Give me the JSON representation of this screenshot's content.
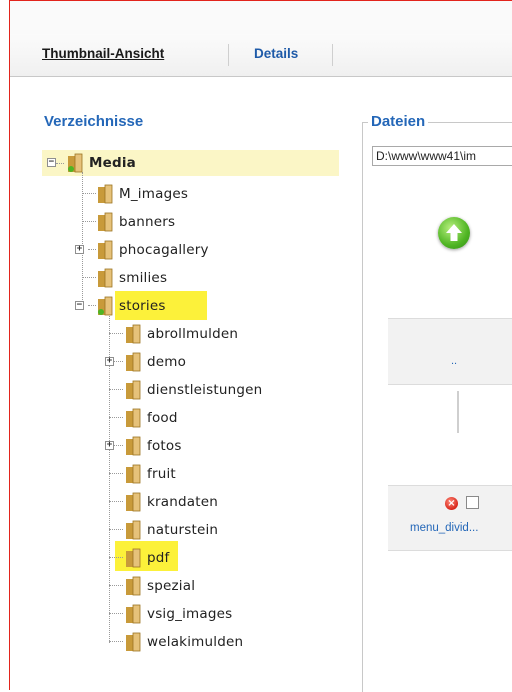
{
  "tabs": {
    "thumbnail": "Thumbnail-Ansicht",
    "details": "Details"
  },
  "directories": {
    "heading": "Verzeichnisse",
    "root": "Media",
    "level1": [
      "M_images",
      "banners",
      "phocagallery",
      "smilies",
      "stories"
    ],
    "stories_children": [
      "abrollmulden",
      "demo",
      "dienstleistungen",
      "food",
      "fotos",
      "fruit",
      "krandaten",
      "naturstein",
      "pdf",
      "spezial",
      "vsig_images",
      "welakimulden"
    ]
  },
  "files": {
    "heading": "Dateien",
    "path": "D:\\www\\www41\\im",
    "parent_label": "..",
    "file_name": "menu_divid..."
  },
  "colors": {
    "link": "#2467b8",
    "highlight": "#fcf13a",
    "root_highlight": "#fbf6c6",
    "frame_border": "#e2241c"
  }
}
